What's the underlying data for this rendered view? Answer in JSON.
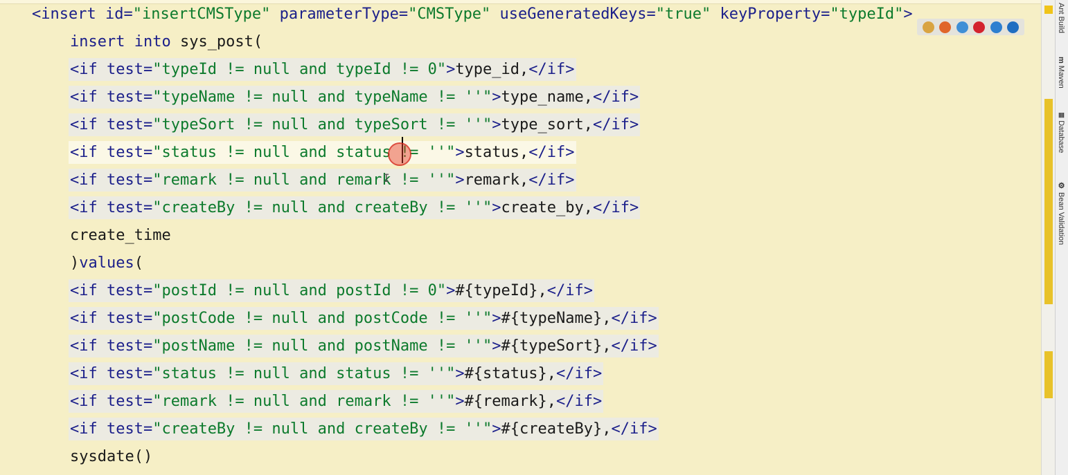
{
  "editor": {
    "lines": [
      {
        "indent": 1,
        "segs": [
          {
            "t": "<insert ",
            "c": "tagc"
          },
          {
            "t": "id=",
            "c": "attrn"
          },
          {
            "t": "\"insertCMSType\"",
            "c": "attrv"
          },
          {
            "t": " parameterType=",
            "c": "attrn"
          },
          {
            "t": "\"CMSType\"",
            "c": "attrv"
          },
          {
            "t": " useGeneratedKeys=",
            "c": "attrn"
          },
          {
            "t": "\"true\"",
            "c": "attrv"
          },
          {
            "t": " keyProperty=",
            "c": "attrn"
          },
          {
            "t": "\"typeId\"",
            "c": "attrv"
          },
          {
            "t": ">",
            "c": "tagc"
          }
        ]
      },
      {
        "indent": 2,
        "segs": [
          {
            "t": "insert into ",
            "c": "kw"
          },
          {
            "t": "sys_post(",
            "c": "plain"
          }
        ]
      },
      {
        "indent": 2,
        "hl": true,
        "segs": [
          {
            "t": "<if ",
            "c": "tagc"
          },
          {
            "t": "test=",
            "c": "attrn"
          },
          {
            "t": "\"typeId != null and typeId != 0\"",
            "c": "attrv"
          },
          {
            "t": ">",
            "c": "tagc"
          },
          {
            "t": "type_id,",
            "c": "plain"
          },
          {
            "t": "</if>",
            "c": "tagc"
          }
        ]
      },
      {
        "indent": 2,
        "hl": true,
        "segs": [
          {
            "t": "<if ",
            "c": "tagc"
          },
          {
            "t": "test=",
            "c": "attrn"
          },
          {
            "t": "\"typeName != null and typeName != ''\"",
            "c": "attrv"
          },
          {
            "t": ">",
            "c": "tagc"
          },
          {
            "t": "type_name,",
            "c": "plain"
          },
          {
            "t": "</if>",
            "c": "tagc"
          }
        ]
      },
      {
        "indent": 2,
        "hl": true,
        "segs": [
          {
            "t": "<if ",
            "c": "tagc"
          },
          {
            "t": "test=",
            "c": "attrn"
          },
          {
            "t": "\"typeSort != null and typeSort != ''\"",
            "c": "attrv"
          },
          {
            "t": ">",
            "c": "tagc"
          },
          {
            "t": "type_sort,",
            "c": "plain"
          },
          {
            "t": "</if>",
            "c": "tagc"
          }
        ]
      },
      {
        "indent": 2,
        "hl": true,
        "caret": true,
        "segs": [
          {
            "t": "<if ",
            "c": "tagc"
          },
          {
            "t": "test=",
            "c": "attrn"
          },
          {
            "t": "\"status != null and status != ''\"",
            "c": "attrv"
          },
          {
            "t": ">",
            "c": "tagc"
          },
          {
            "t": "status,",
            "c": "plain"
          },
          {
            "t": "</if>",
            "c": "tagc"
          }
        ]
      },
      {
        "indent": 2,
        "hl": true,
        "segs": [
          {
            "t": "<if ",
            "c": "tagc"
          },
          {
            "t": "test=",
            "c": "attrn"
          },
          {
            "t": "\"remark != null and remark != ''\"",
            "c": "attrv"
          },
          {
            "t": ">",
            "c": "tagc"
          },
          {
            "t": "remark,",
            "c": "plain"
          },
          {
            "t": "</if>",
            "c": "tagc"
          }
        ]
      },
      {
        "indent": 2,
        "hl": true,
        "segs": [
          {
            "t": "<if ",
            "c": "tagc"
          },
          {
            "t": "test=",
            "c": "attrn"
          },
          {
            "t": "\"createBy != null and createBy != ''\"",
            "c": "attrv"
          },
          {
            "t": ">",
            "c": "tagc"
          },
          {
            "t": "create_by,",
            "c": "plain"
          },
          {
            "t": "</if>",
            "c": "tagc"
          }
        ]
      },
      {
        "indent": 2,
        "segs": [
          {
            "t": "create_time",
            "c": "plain"
          }
        ]
      },
      {
        "indent": 2,
        "segs": [
          {
            "t": ")",
            "c": "plain"
          },
          {
            "t": "values",
            "c": "kw"
          },
          {
            "t": "(",
            "c": "plain"
          }
        ]
      },
      {
        "indent": 2,
        "hl": true,
        "segs": [
          {
            "t": "<if ",
            "c": "tagc"
          },
          {
            "t": "test=",
            "c": "attrn"
          },
          {
            "t": "\"postId != null and postId != 0\"",
            "c": "attrv"
          },
          {
            "t": ">",
            "c": "tagc"
          },
          {
            "t": "#{typeId},",
            "c": "plain"
          },
          {
            "t": "</if>",
            "c": "tagc"
          }
        ]
      },
      {
        "indent": 2,
        "hl": true,
        "segs": [
          {
            "t": "<if ",
            "c": "tagc"
          },
          {
            "t": "test=",
            "c": "attrn"
          },
          {
            "t": "\"postCode != null and postCode != ''\"",
            "c": "attrv"
          },
          {
            "t": ">",
            "c": "tagc"
          },
          {
            "t": "#{typeName},",
            "c": "plain"
          },
          {
            "t": "</if>",
            "c": "tagc"
          }
        ]
      },
      {
        "indent": 2,
        "hl": true,
        "segs": [
          {
            "t": "<if ",
            "c": "tagc"
          },
          {
            "t": "test=",
            "c": "attrn"
          },
          {
            "t": "\"postName != null and postName != ''\"",
            "c": "attrv"
          },
          {
            "t": ">",
            "c": "tagc"
          },
          {
            "t": "#{typeSort},",
            "c": "plain"
          },
          {
            "t": "</if>",
            "c": "tagc"
          }
        ]
      },
      {
        "indent": 2,
        "hl": true,
        "segs": [
          {
            "t": "<if ",
            "c": "tagc"
          },
          {
            "t": "test=",
            "c": "attrn"
          },
          {
            "t": "\"status != null and status != ''\"",
            "c": "attrv"
          },
          {
            "t": ">",
            "c": "tagc"
          },
          {
            "t": "#{status},",
            "c": "plain"
          },
          {
            "t": "</if>",
            "c": "tagc"
          }
        ]
      },
      {
        "indent": 2,
        "hl": true,
        "segs": [
          {
            "t": "<if ",
            "c": "tagc"
          },
          {
            "t": "test=",
            "c": "attrn"
          },
          {
            "t": "\"remark != null and remark != ''\"",
            "c": "attrv"
          },
          {
            "t": ">",
            "c": "tagc"
          },
          {
            "t": "#{remark},",
            "c": "plain"
          },
          {
            "t": "</if>",
            "c": "tagc"
          }
        ]
      },
      {
        "indent": 2,
        "hl": true,
        "segs": [
          {
            "t": "<if ",
            "c": "tagc"
          },
          {
            "t": "test=",
            "c": "attrn"
          },
          {
            "t": "\"createBy != null and createBy != ''\"",
            "c": "attrv"
          },
          {
            "t": ">",
            "c": "tagc"
          },
          {
            "t": "#{createBy},",
            "c": "plain"
          },
          {
            "t": "</if>",
            "c": "tagc"
          }
        ]
      },
      {
        "indent": 2,
        "segs": [
          {
            "t": "sysdate()",
            "c": "plain"
          }
        ]
      }
    ]
  },
  "browser_icons": [
    {
      "name": "chrome-icon",
      "color": "#d9a441"
    },
    {
      "name": "firefox-icon",
      "color": "#e0662a"
    },
    {
      "name": "safari-icon",
      "color": "#3f8fd6"
    },
    {
      "name": "opera-icon",
      "color": "#d3232e"
    },
    {
      "name": "ie-icon",
      "color": "#2d7fd0"
    },
    {
      "name": "edge-icon",
      "color": "#1f6ec1"
    }
  ],
  "tool_windows": [
    {
      "name": "tool-window-ant-build",
      "label": "Ant Build",
      "icon": ""
    },
    {
      "name": "tool-window-maven",
      "label": "Maven",
      "icon": "m"
    },
    {
      "name": "tool-window-database",
      "label": "Database",
      "icon": "≣"
    },
    {
      "name": "tool-window-bean-validation",
      "label": "Bean Validation",
      "icon": "⚙"
    }
  ],
  "colors": {
    "editor_bg": "#f6efc6",
    "tag": "#1b1f8a",
    "attr_value": "#0c7a2c",
    "highlight": "#ecebe2",
    "marker": "#e8c22a"
  }
}
